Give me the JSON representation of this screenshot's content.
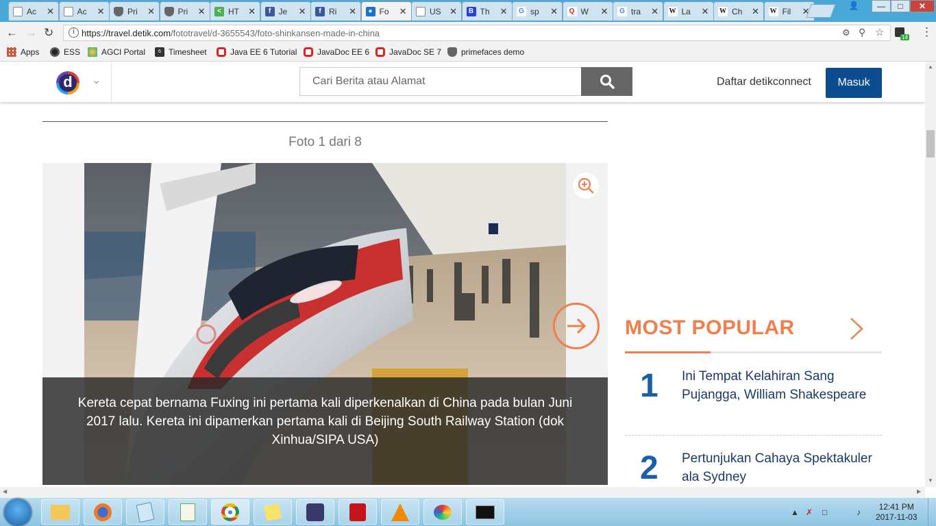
{
  "browser": {
    "tabs": [
      {
        "label": "Ac",
        "icon": "page-icon"
      },
      {
        "label": "Ac",
        "icon": "page-icon"
      },
      {
        "label": "Pri",
        "icon": "shield-icon"
      },
      {
        "label": "Pri",
        "icon": "shield-icon"
      },
      {
        "label": "HT",
        "icon": "html-icon"
      },
      {
        "label": "Je",
        "icon": "facebook-icon"
      },
      {
        "label": "Ri",
        "icon": "facebook-icon"
      },
      {
        "label": "Fo",
        "icon": "detik-icon"
      },
      {
        "label": "US",
        "icon": "page-icon"
      },
      {
        "label": "Th",
        "icon": "b-icon"
      },
      {
        "label": "sp",
        "icon": "google-icon"
      },
      {
        "label": "W",
        "icon": "quora-icon"
      },
      {
        "label": "tra",
        "icon": "google-icon"
      },
      {
        "label": "La",
        "icon": "wikipedia-icon"
      },
      {
        "label": "Ch",
        "icon": "wikipedia-icon"
      },
      {
        "label": "Fil",
        "icon": "wikipedia-icon"
      }
    ],
    "url_host": "https://travel.detik.com",
    "url_path": "/fototravel/d-3655543/foto-shinkansen-made-in-china",
    "extension_badge": "14",
    "bookmarks": [
      {
        "label": "Apps",
        "icon": "apps-grid-icon"
      },
      {
        "label": "ESS",
        "icon": "circle-icon"
      },
      {
        "label": "AGCI Portal",
        "icon": "portal-icon"
      },
      {
        "label": "Timesheet",
        "icon": "sap-icon"
      },
      {
        "label": "Java EE 6 Tutorial",
        "icon": "oracle-icon"
      },
      {
        "label": "JavaDoc EE 6",
        "icon": "oracle-icon"
      },
      {
        "label": "JavaDoc SE 7",
        "icon": "oracle-icon"
      },
      {
        "label": "primefaces demo",
        "icon": "shield-icon"
      }
    ]
  },
  "site": {
    "logo_letter": "d",
    "search_placeholder": "Cari Berita atau Alamat",
    "daftar_label": "Daftar detikconnect",
    "masuk_label": "Masuk"
  },
  "gallery": {
    "counter": "Foto 1 dari 8",
    "caption": "Kereta cepat bernama Fuxing ini pertama kali diperkenalkan di China pada bulan Juni 2017 lalu. Kereta ini dipamerkan pertama kali di Beijing South Railway Station (dok Xinhua/SIPA USA)"
  },
  "most_popular": {
    "title": "MOST POPULAR",
    "items": [
      {
        "rank": "1",
        "title": "Ini Tempat Kelahiran Sang Pujangga, William Shakespeare"
      },
      {
        "rank": "2",
        "title": "Pertunjukan Cahaya Spektakuler ala Sydney"
      }
    ]
  },
  "taskbar": {
    "time": "12:41 PM",
    "date": "2017-11-03"
  },
  "colors": {
    "accent_orange": "#f07f4b",
    "masuk_blue": "#0b4d8e",
    "rank_blue": "#1a5fa8"
  }
}
